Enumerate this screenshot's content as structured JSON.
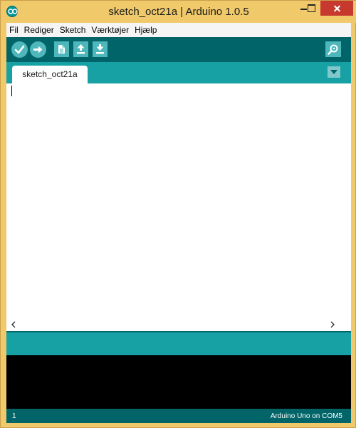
{
  "window": {
    "title": "sketch_oct21a | Arduino 1.0.5"
  },
  "menu": {
    "items": [
      "Fil",
      "Rediger",
      "Sketch",
      "Værktøjer",
      "Hjælp"
    ]
  },
  "toolbar": {
    "buttons": [
      "verify-icon",
      "upload-icon",
      "new-icon",
      "open-icon",
      "save-icon"
    ],
    "serial_monitor": "serial-monitor-icon"
  },
  "tabs": [
    {
      "label": "sketch_oct21a"
    }
  ],
  "editor": {
    "content": ""
  },
  "status": {
    "line": "1",
    "board": "Arduino Uno on COM5"
  },
  "colors": {
    "frame": "#f0c96b",
    "toolbar": "#006468",
    "tabbar": "#17a1a5",
    "button": "#4db7bb",
    "console": "#000000",
    "close": "#c7392e"
  }
}
